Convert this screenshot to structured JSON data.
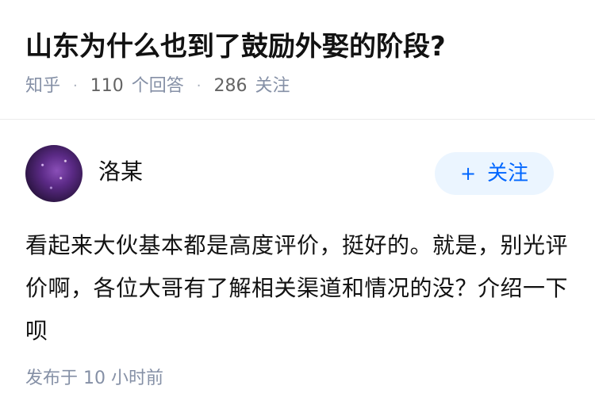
{
  "question": {
    "title": "山东为什么也到了鼓励外娶的阶段?",
    "source": "知乎",
    "answer_count": "110",
    "answer_label": "个回答",
    "follower_count": "286",
    "follower_label": "关注"
  },
  "answer": {
    "author": {
      "name": "洛某",
      "avatar_icon": "avatar-galaxy-purple"
    },
    "follow_button": {
      "icon": "plus-icon",
      "plus": "+",
      "label": "关注"
    },
    "content": "看起来大伙基本都是高度评价，挺好的。就是，别光评价啊，各位大哥有了解相关渠道和情况的没？介绍一下呗",
    "time": "发布于 10 小时前"
  },
  "colors": {
    "text": "#121212",
    "meta": "#8590a6",
    "accent": "#0066ff",
    "button_bg": "#ebf5ff",
    "divider": "#ebebeb"
  }
}
